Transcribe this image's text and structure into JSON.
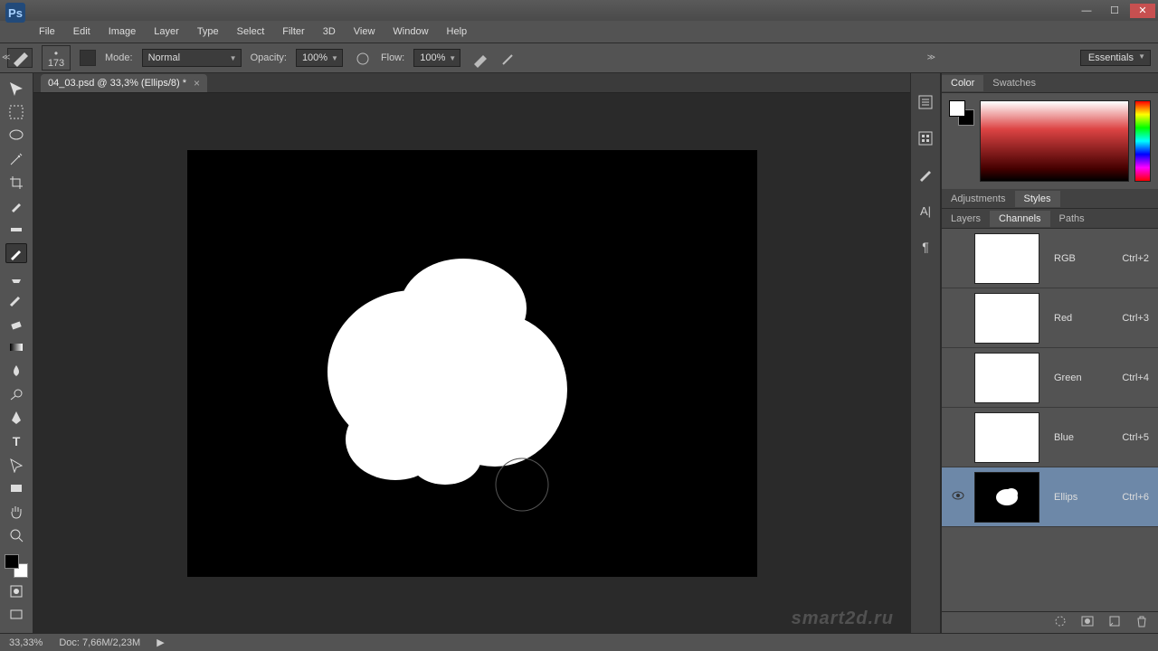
{
  "app": {
    "logo": "Ps"
  },
  "menu": [
    "File",
    "Edit",
    "Image",
    "Layer",
    "Type",
    "Select",
    "Filter",
    "3D",
    "View",
    "Window",
    "Help"
  ],
  "options": {
    "brush_size": "173",
    "mode_label": "Mode:",
    "mode_value": "Normal",
    "opacity_label": "Opacity:",
    "opacity_value": "100%",
    "flow_label": "Flow:",
    "flow_value": "100%",
    "workspace": "Essentials"
  },
  "tab": {
    "title": "04_03.psd @ 33,3% (Ellips/8) *"
  },
  "panels": {
    "color_tabs": [
      "Color",
      "Swatches"
    ],
    "adj_tabs": [
      "Adjustments",
      "Styles"
    ],
    "lcp_tabs": [
      "Layers",
      "Channels",
      "Paths"
    ]
  },
  "channels": [
    {
      "name": "RGB",
      "shortcut": "Ctrl+2",
      "visible": false,
      "thumb": "white"
    },
    {
      "name": "Red",
      "shortcut": "Ctrl+3",
      "visible": false,
      "thumb": "white"
    },
    {
      "name": "Green",
      "shortcut": "Ctrl+4",
      "visible": false,
      "thumb": "white"
    },
    {
      "name": "Blue",
      "shortcut": "Ctrl+5",
      "visible": false,
      "thumb": "white"
    },
    {
      "name": "Ellips",
      "shortcut": "Ctrl+6",
      "visible": true,
      "thumb": "ellips",
      "selected": true
    }
  ],
  "status": {
    "zoom": "33,33%",
    "doc": "Doc: 7,66M/2,23M"
  },
  "watermark": "smart2d.ru"
}
